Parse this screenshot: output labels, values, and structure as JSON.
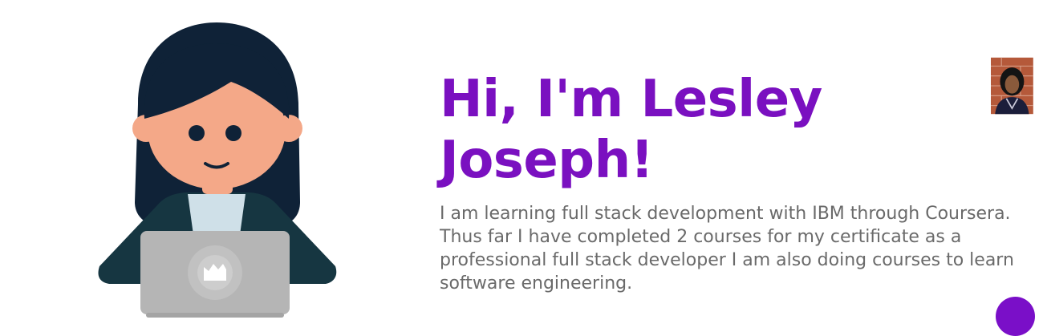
{
  "hero": {
    "title": "Hi, I'm Lesley Joseph!",
    "description": "I am learning full stack development with IBM through Coursera. Thus far I have completed 2 courses for my certificate as a professional full stack developer I am also doing courses to learn software engineering."
  },
  "colors": {
    "title": "#7a10c0",
    "body_text": "#6a6a6a",
    "accent_button": "#7a0fc8",
    "hair": "#0f2237",
    "skin": "#f4a888",
    "jacket": "#163641",
    "laptop": "#b5b5b5"
  },
  "icons": {
    "illustration": "person-with-laptop-illustration",
    "avatar": "profile-photo",
    "fab": "circle-button"
  }
}
